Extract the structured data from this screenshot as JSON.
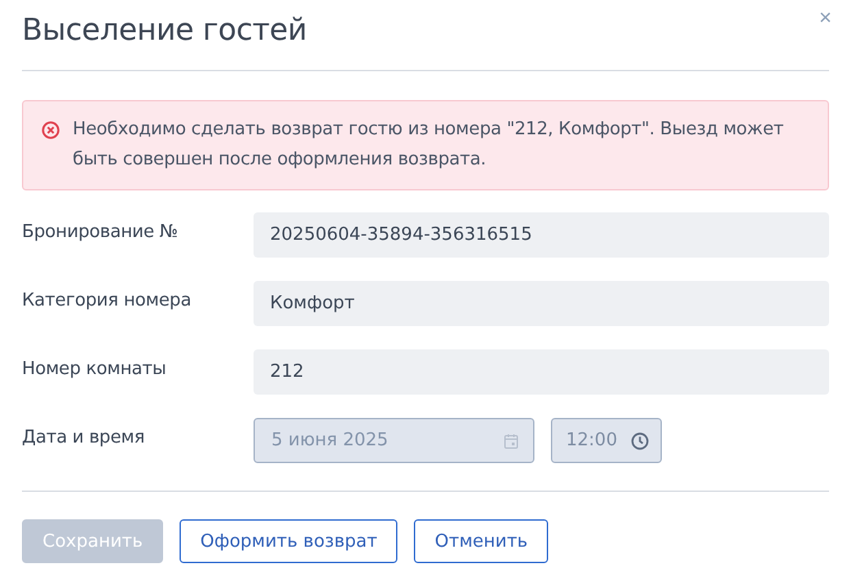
{
  "dialog": {
    "title": "Выселение гостей",
    "close": "×"
  },
  "alert": {
    "kind": "error",
    "text": "Необходимо сделать возврат гостю из номера \"212, Комфорт\". Выезд может быть совершен после оформления возврата."
  },
  "fields": [
    {
      "kind": "text",
      "label": "Бронирование №",
      "value": "20250604-35894-356316515"
    },
    {
      "kind": "text",
      "label": "Категория номера",
      "value": "Комфорт"
    },
    {
      "kind": "text",
      "label": "Номер комнаты",
      "value": "212"
    },
    {
      "kind": "datetime",
      "label": "Дата и время",
      "date": "5 июня 2025",
      "time": "12:00",
      "disabled": true
    }
  ],
  "buttons": [
    {
      "label": "Сохранить",
      "kind": "primary",
      "disabled": true
    },
    {
      "label": "Оформить возврат",
      "kind": "outline",
      "disabled": false
    },
    {
      "label": "Отменить",
      "kind": "outline",
      "disabled": false
    }
  ]
}
